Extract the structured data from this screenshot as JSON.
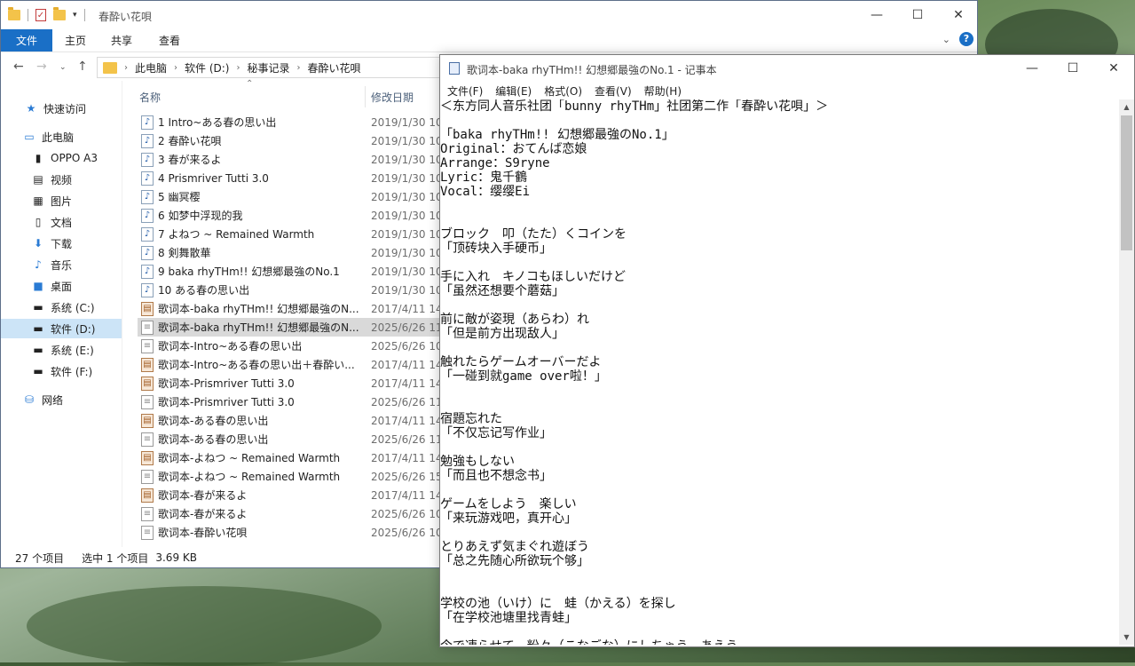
{
  "explorer": {
    "title": "春酔い花唄",
    "ribbon_tabs": [
      "文件",
      "主页",
      "共享",
      "查看"
    ],
    "breadcrumb": [
      "此电脑",
      "软件 (D:)",
      "秘事记录",
      "春酔い花唄"
    ],
    "nav": {
      "quick_access": "快速访问",
      "this_pc": "此电脑",
      "items": [
        "OPPO A3",
        "视频",
        "图片",
        "文档",
        "下载",
        "音乐",
        "桌面",
        "系统 (C:)",
        "软件 (D:)",
        "系统 (E:)",
        "软件 (F:)"
      ],
      "network": "网络"
    },
    "columns": {
      "name": "名称",
      "date": "修改日期"
    },
    "files": [
      {
        "name": "1 Intro~ある春の思い出",
        "date": "2019/1/30 10:",
        "type": "audio"
      },
      {
        "name": "2 春酔い花唄",
        "date": "2019/1/30 10:",
        "type": "audio"
      },
      {
        "name": "3 春が来るよ",
        "date": "2019/1/30 10:",
        "type": "audio"
      },
      {
        "name": "4 Prismriver Tutti 3.0",
        "date": "2019/1/30 10:",
        "type": "audio"
      },
      {
        "name": "5 幽冥樱",
        "date": "2019/1/30 10:",
        "type": "audio"
      },
      {
        "name": "6 如梦中浮现的我",
        "date": "2019/1/30 10:",
        "type": "audio"
      },
      {
        "name": "7 よねつ ~ Remained Warmth",
        "date": "2019/1/30 10:",
        "type": "audio"
      },
      {
        "name": "8 剣舞散華",
        "date": "2019/1/30 10:",
        "type": "audio"
      },
      {
        "name": "9 baka rhyTHm!! 幻想郷最強のNo.1",
        "date": "2019/1/30 10:",
        "type": "audio"
      },
      {
        "name": "10 ある春の思い出",
        "date": "2019/1/30 10:",
        "type": "audio"
      },
      {
        "name": "歌词本-baka rhyTHm!! 幻想郷最強のN...",
        "date": "2017/4/11 14:",
        "type": "rtf"
      },
      {
        "name": "歌词本-baka rhyTHm!! 幻想郷最強のN...",
        "date": "2025/6/26 11:",
        "type": "txt"
      },
      {
        "name": "歌词本-Intro~ある春の思い出",
        "date": "2025/6/26 10:",
        "type": "txt"
      },
      {
        "name": "歌词本-Intro~ある春の思い出＋春酔い...",
        "date": "2017/4/11 14:",
        "type": "rtf"
      },
      {
        "name": "歌词本-Prismriver Tutti 3.0",
        "date": "2017/4/11 14:",
        "type": "rtf"
      },
      {
        "name": "歌词本-Prismriver Tutti 3.0",
        "date": "2025/6/26 11:",
        "type": "txt"
      },
      {
        "name": "歌词本-ある春の思い出",
        "date": "2017/4/11 14:",
        "type": "rtf"
      },
      {
        "name": "歌词本-ある春の思い出",
        "date": "2025/6/26 11:",
        "type": "txt"
      },
      {
        "name": "歌词本-よねつ ~ Remained Warmth",
        "date": "2017/4/11 14:",
        "type": "rtf"
      },
      {
        "name": "歌词本-よねつ ~ Remained Warmth",
        "date": "2025/6/26 15:",
        "type": "txt"
      },
      {
        "name": "歌词本-春が来るよ",
        "date": "2017/4/11 14:",
        "type": "rtf"
      },
      {
        "name": "歌词本-春が来るよ",
        "date": "2025/6/26 10:",
        "type": "txt"
      },
      {
        "name": "歌词本-春酔い花唄",
        "date": "2025/6/26 10:",
        "type": "txt"
      }
    ],
    "selected_index": 11,
    "status": {
      "count": "27 个项目",
      "selected": "选中 1 个项目",
      "size": "3.69 KB"
    }
  },
  "notepad": {
    "title": "歌词本-baka rhyTHm!! 幻想郷最強のNo.1 - 记事本",
    "menu": [
      "文件(F)",
      "编辑(E)",
      "格式(O)",
      "查看(V)",
      "帮助(H)"
    ],
    "lines": [
      "＜东方同人音乐社团「bunny rhyTHm」社团第二作「春酔い花唄」＞",
      "",
      "「baka rhyTHm!! 幻想郷最強のNo.1」",
      "Original：おてんば恋娘",
      "Arrange：S9ryne",
      "Lyric：鬼千鶴",
      "Vocal：缨缨Ei",
      "",
      "",
      "ブロック　叩（たた）くコインを",
      "「顶砖块入手硬币」",
      "",
      "手に入れ　キノコもほしいだけど",
      "「虽然还想要个蘑菇」",
      "",
      "前に敵が姿現（あらわ）れ",
      "「但是前方出现敌人」",
      "",
      "触れたらゲームオーバーだよ",
      "「一碰到就game over啦！」",
      "",
      "",
      "宿題忘れた",
      "「不仅忘记写作业」",
      "",
      "勉強もしない",
      "「而且也不想念书」",
      "",
      "ゲームをしよう　楽しい",
      "「来玩游戏吧，真开心」",
      "",
      "とりあえず気まぐれ遊ぼう",
      "「总之先随心所欲玩个够」",
      "",
      "",
      "学校の池（いけ）に　蛙（かえる）を探し",
      "「在学校池塘里找青蛙」",
      "",
      "今で凍らせて　粉々（こなごな）にしちゃう　あえう"
    ]
  },
  "colors": {
    "accent": "#1a6fc6",
    "selection": "#cce4f7",
    "row_selected": "#d9d9d9"
  }
}
